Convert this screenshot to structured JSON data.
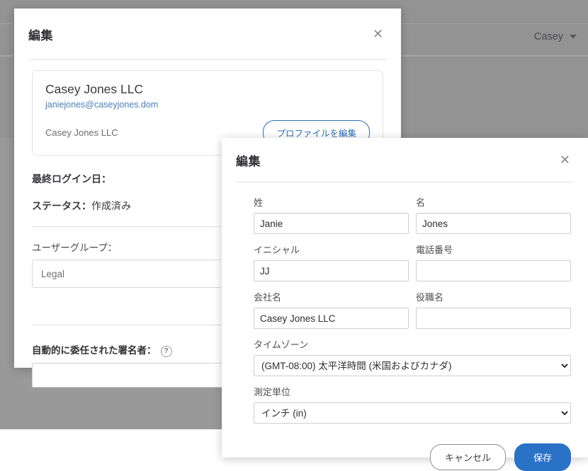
{
  "background": {
    "user_menu_label": "Casey",
    "caret_icon": "chevron-down-icon"
  },
  "left_modal": {
    "title": "編集",
    "close_icon": "close-icon",
    "profile": {
      "name": "Casey Jones LLC",
      "email": "janiejones@caseyjones.dom",
      "organization": "Casey Jones LLC",
      "edit_profile_button": "プロファイルを編集"
    },
    "last_login_label": "最終ログイン日：",
    "status_label": "ステータス：",
    "status_value": "作成済み",
    "user_group_label": "ユーザーグループ：",
    "user_group_value": "Legal",
    "auto_delegate_label": "自動的に委任された署名者：",
    "auto_delegate_value": "",
    "help_icon": "help-circle-icon"
  },
  "right_modal": {
    "title": "編集",
    "close_icon": "close-icon",
    "fields": {
      "last_name_label": "姓",
      "last_name_value": "Janie",
      "first_name_label": "名",
      "first_name_value": "Jones",
      "initials_label": "イニシャル",
      "initials_value": "JJ",
      "phone_label": "電話番号",
      "phone_value": "",
      "company_label": "会社名",
      "company_value": "Casey Jones LLC",
      "job_title_label": "役職名",
      "job_title_value": "",
      "timezone_label": "タイムゾーン",
      "timezone_value": "(GMT-08:00) 太平洋時間 (米国およびカナダ)",
      "unit_label": "測定単位",
      "unit_value": "インチ (in)"
    },
    "cancel_button": "キャンセル",
    "save_button": "保存"
  },
  "colors": {
    "accent": "#2a72c5",
    "link": "#4a7fb5",
    "backdrop": "#999999"
  }
}
